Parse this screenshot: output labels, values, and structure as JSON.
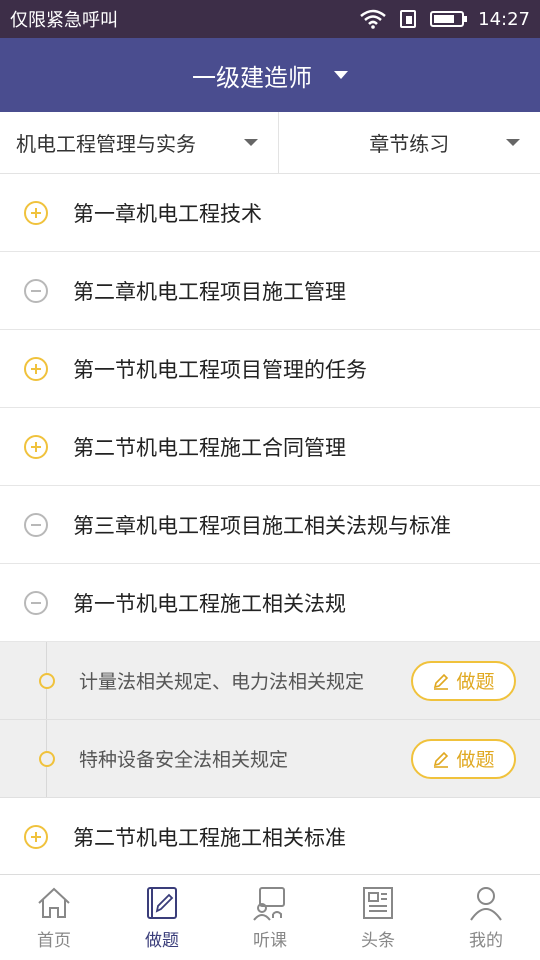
{
  "status_bar": {
    "carrier": "仅限紧急呼叫",
    "time": "14:27",
    "battery_level": 0.75
  },
  "header": {
    "title": "一级建造师"
  },
  "filters": {
    "subject": "机电工程管理与实务",
    "mode": "章节练习"
  },
  "list": {
    "rows": [
      {
        "label": "第一章机电工程技术",
        "state": "collapsed"
      },
      {
        "label": "第二章机电工程项目施工管理",
        "state": "expanded"
      },
      {
        "label": "第一节机电工程项目管理的任务",
        "state": "collapsed"
      },
      {
        "label": "第二节机电工程施工合同管理",
        "state": "collapsed"
      },
      {
        "label": "第三章机电工程项目施工相关法规与标准",
        "state": "expanded"
      },
      {
        "label": "第一节机电工程施工相关法规",
        "state": "expanded"
      }
    ],
    "sub_items": [
      {
        "label": "计量法相关规定、电力法相关规定",
        "button": "做题"
      },
      {
        "label": "特种设备安全法相关规定",
        "button": "做题"
      }
    ],
    "last_row": {
      "label": "第二节机电工程施工相关标准",
      "state": "collapsed"
    }
  },
  "tabs": [
    {
      "label": "首页",
      "icon": "home-icon",
      "active": false
    },
    {
      "label": "做题",
      "icon": "notebook-pencil-icon",
      "active": true
    },
    {
      "label": "听课",
      "icon": "lecture-icon",
      "active": false
    },
    {
      "label": "头条",
      "icon": "newspaper-icon",
      "active": false
    },
    {
      "label": "我的",
      "icon": "person-icon",
      "active": false
    }
  ],
  "colors": {
    "accent": "#f0c23c",
    "header": "#4a4d8f",
    "status": "#3d2e48",
    "active_tab": "#3a3d7a"
  }
}
